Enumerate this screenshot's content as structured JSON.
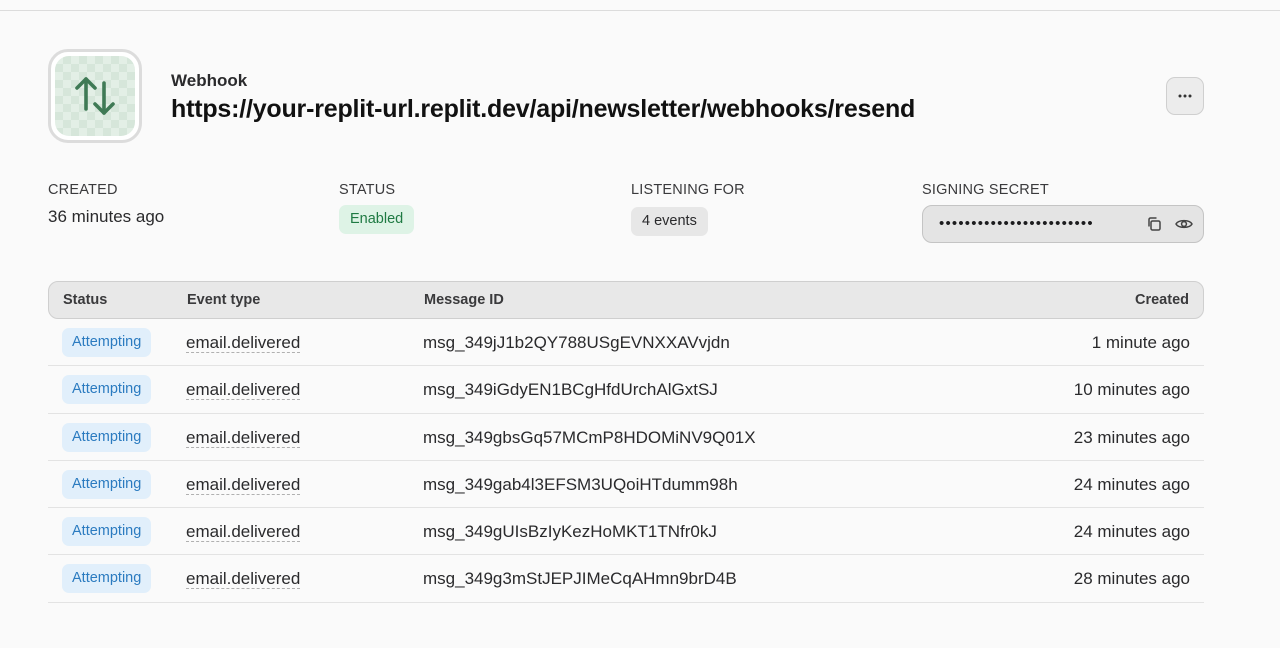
{
  "webhook": {
    "kind_label": "Webhook",
    "url": "https://your-replit-url.replit.dev/api/newsletter/webhooks/resend",
    "logo_icon": "arrows-up-down-icon",
    "more_label": "···"
  },
  "meta": {
    "created": {
      "label": "CREATED",
      "value": "36 minutes ago"
    },
    "status": {
      "label": "STATUS",
      "value": "Enabled",
      "color": "#1f7a43"
    },
    "listening": {
      "label": "LISTENING FOR",
      "value": "4 events"
    },
    "secret": {
      "label": "SIGNING SECRET",
      "masked": "••••••••••••••••••••••••",
      "copy_icon": "copy-icon",
      "reveal_icon": "eye-icon"
    }
  },
  "table": {
    "headers": {
      "status": "Status",
      "event_type": "Event type",
      "message_id": "Message ID",
      "created": "Created"
    },
    "rows": [
      {
        "status": "Attempting",
        "event_type": "email.delivered",
        "message_id": "msg_349jJ1b2QY788USgEVNXXAVvjdn",
        "created": "1 minute ago"
      },
      {
        "status": "Attempting",
        "event_type": "email.delivered",
        "message_id": "msg_349iGdyEN1BCgHfdUrchAlGxtSJ",
        "created": "10 minutes ago"
      },
      {
        "status": "Attempting",
        "event_type": "email.delivered",
        "message_id": "msg_349gbsGq57MCmP8HDOMiNV9Q01X",
        "created": "23 minutes ago"
      },
      {
        "status": "Attempting",
        "event_type": "email.delivered",
        "message_id": "msg_349gab4l3EFSM3UQoiHTdumm98h",
        "created": "24 minutes ago"
      },
      {
        "status": "Attempting",
        "event_type": "email.delivered",
        "message_id": "msg_349gUIsBzIyKezHoMKT1TNfr0kJ",
        "created": "24 minutes ago"
      },
      {
        "status": "Attempting",
        "event_type": "email.delivered",
        "message_id": "msg_349g3mStJEPJIMeCqAHmn9brD4B",
        "created": "28 minutes ago"
      }
    ]
  },
  "colors": {
    "status_attempting_bg": "#e1effb",
    "status_attempting_text": "#2b7bc0",
    "enabled_bg": "#def3e6",
    "logo_arrows": "#3f7a55"
  }
}
